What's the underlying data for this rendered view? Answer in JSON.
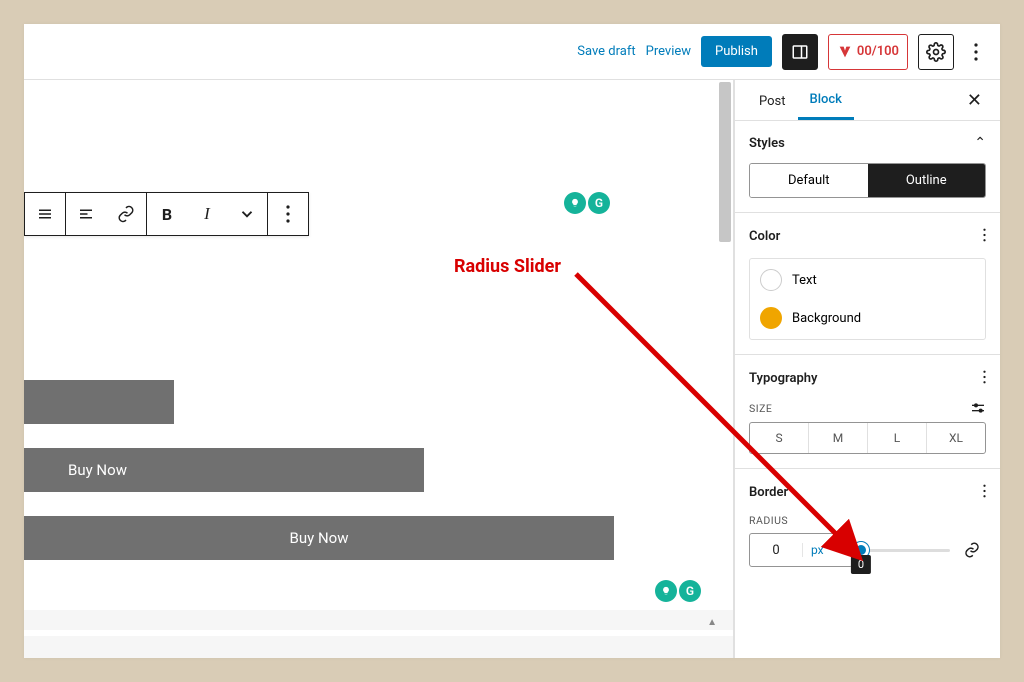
{
  "topbar": {
    "save_draft": "Save draft",
    "preview": "Preview",
    "publish": "Publish",
    "score": "00/100"
  },
  "sidebar": {
    "tabs": {
      "post": "Post",
      "block": "Block"
    },
    "styles": {
      "title": "Styles",
      "default": "Default",
      "outline": "Outline"
    },
    "color": {
      "title": "Color",
      "text": "Text",
      "background": "Background"
    },
    "typography": {
      "title": "Typography",
      "size_label": "SIZE",
      "sizes": [
        "S",
        "M",
        "L",
        "XL"
      ]
    },
    "border": {
      "title": "Border",
      "radius_label": "RADIUS",
      "radius_value": "0",
      "radius_unit": "px",
      "tooltip": "0"
    }
  },
  "editor": {
    "buy_now": "Buy Now"
  },
  "annotation": {
    "label": "Radius Slider"
  }
}
